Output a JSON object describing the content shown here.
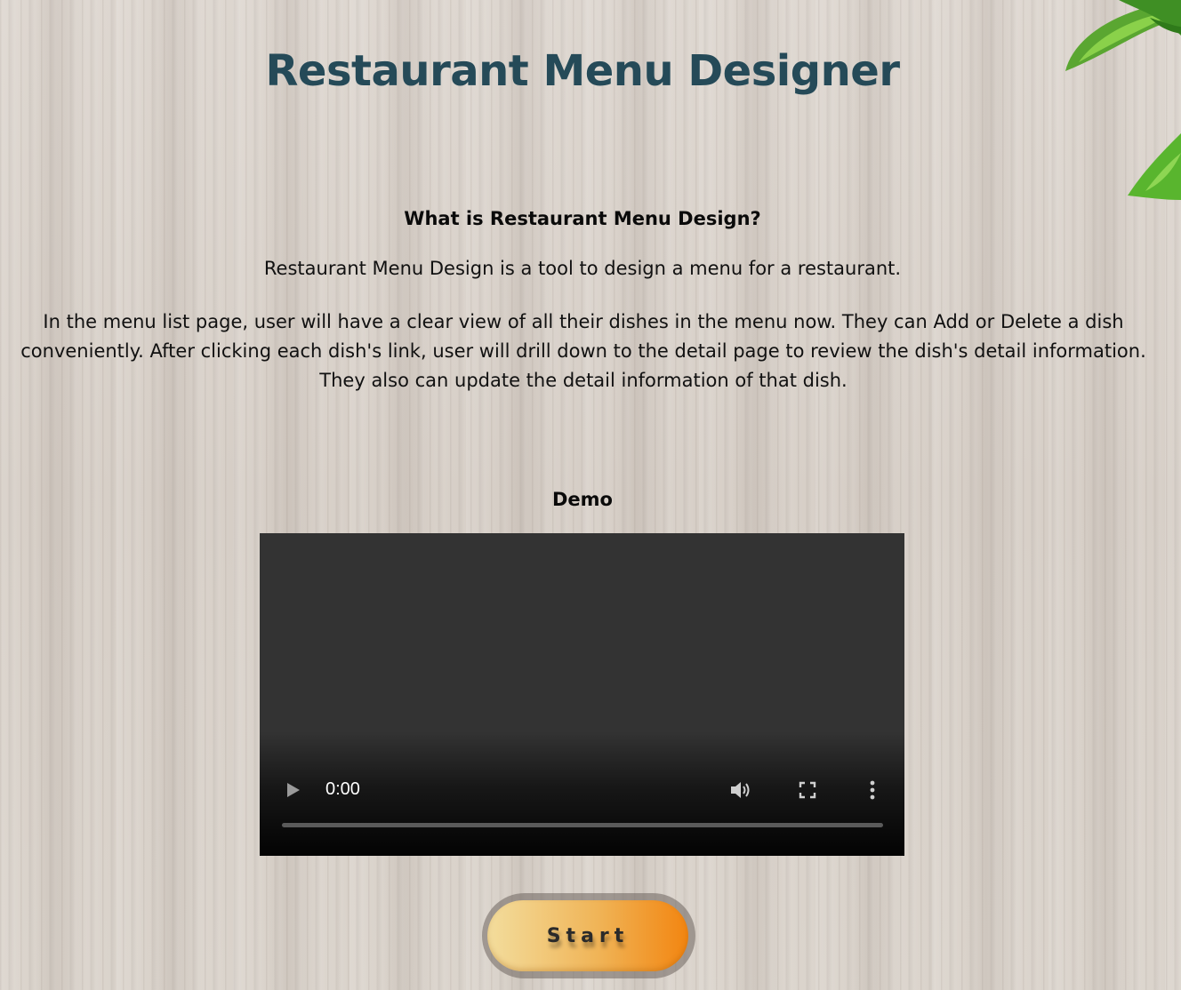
{
  "header": {
    "title": "Restaurant Menu Designer"
  },
  "intro": {
    "heading": "What is Restaurant Menu Design?",
    "summary": "Restaurant Menu Design is a tool to design a menu for a restaurant.",
    "description": "In the menu list page, user will have a clear view of all their dishes in the menu now. They can Add or Delete a dish conveniently. After clicking each dish's link, user will drill down to the detail page to review the dish's detail information. They also can update the detail information of that dish."
  },
  "demo": {
    "heading": "Demo",
    "video": {
      "current_time": "0:00",
      "progress": 0,
      "icons": [
        "play-icon",
        "volume-icon",
        "fullscreen-icon",
        "more-options-icon"
      ]
    }
  },
  "actions": {
    "start_label": "Start"
  },
  "colors": {
    "title": "#254a58",
    "video_background": "#333333",
    "start_gradient": [
      "#f3dd9d",
      "#f0b457",
      "#f28510"
    ]
  }
}
